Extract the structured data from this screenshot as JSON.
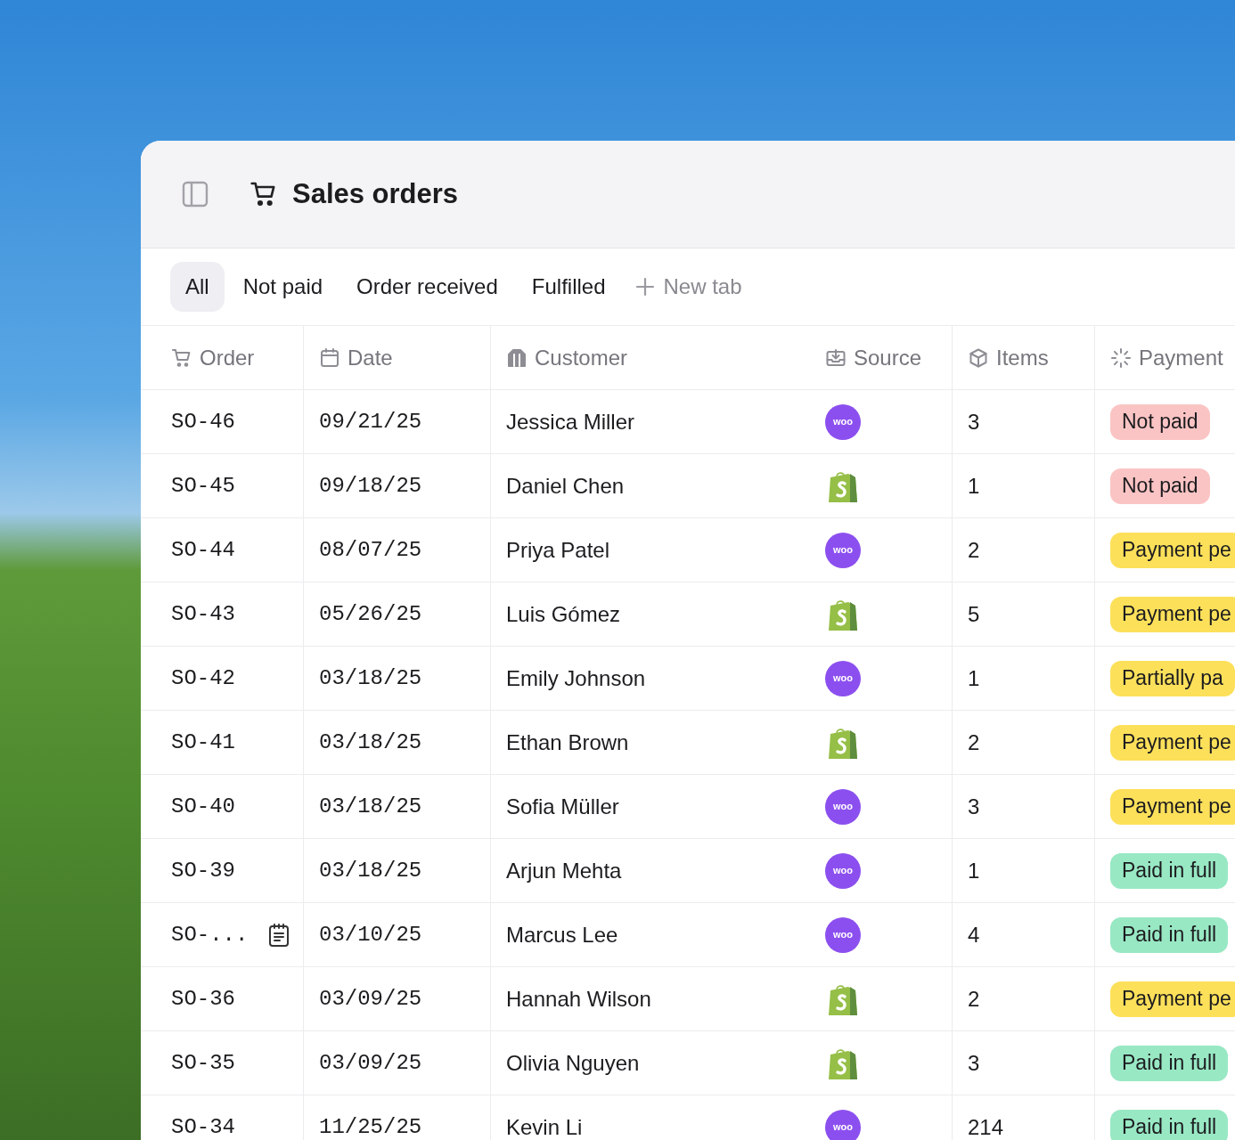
{
  "window": {
    "title": "Sales orders"
  },
  "tabs": [
    {
      "label": "All",
      "selected": true
    },
    {
      "label": "Not paid",
      "selected": false
    },
    {
      "label": "Order received",
      "selected": false
    },
    {
      "label": "Fulfilled",
      "selected": false
    }
  ],
  "new_tab": {
    "label": "New tab"
  },
  "table": {
    "columns": [
      {
        "kind": "cart",
        "label": "Order"
      },
      {
        "kind": "calendar",
        "label": "Date"
      },
      {
        "kind": "building",
        "label": "Customer"
      },
      {
        "kind": "inbox",
        "label": "Source"
      },
      {
        "kind": "cube",
        "label": "Items"
      },
      {
        "kind": "spinner",
        "label": "Payment"
      }
    ],
    "rows": [
      {
        "order": "SO-46",
        "note": false,
        "date": "09/21/25",
        "customer": "Jessica Miller",
        "source": {
          "kind": "circle",
          "text": "woo"
        },
        "items": "3",
        "payment": {
          "label": "Not paid",
          "color": "#fbc4c4"
        }
      },
      {
        "order": "SO-45",
        "note": false,
        "date": "09/18/25",
        "customer": "Daniel Chen",
        "source": {
          "kind": "bag"
        },
        "items": "1",
        "payment": {
          "label": "Not paid",
          "color": "#fbc4c4"
        }
      },
      {
        "order": "SO-44",
        "note": false,
        "date": "08/07/25",
        "customer": "Priya Patel",
        "source": {
          "kind": "circle",
          "text": "woo"
        },
        "items": "2",
        "payment": {
          "label": "Payment pe",
          "color": "#fde05a"
        }
      },
      {
        "order": "SO-43",
        "note": false,
        "date": "05/26/25",
        "customer": "Luis Gómez",
        "source": {
          "kind": "bag"
        },
        "items": "5",
        "payment": {
          "label": "Payment pe",
          "color": "#fde05a"
        }
      },
      {
        "order": "SO-42",
        "note": false,
        "date": "03/18/25",
        "customer": "Emily Johnson",
        "source": {
          "kind": "circle",
          "text": "woo"
        },
        "items": "1",
        "payment": {
          "label": "Partially pa",
          "color": "#fde05a"
        }
      },
      {
        "order": "SO-41",
        "note": false,
        "date": "03/18/25",
        "customer": "Ethan Brown",
        "source": {
          "kind": "bag"
        },
        "items": "2",
        "payment": {
          "label": "Payment pe",
          "color": "#fde05a"
        }
      },
      {
        "order": "SO-40",
        "note": false,
        "date": "03/18/25",
        "customer": "Sofia Müller",
        "source": {
          "kind": "circle",
          "text": "woo"
        },
        "items": "3",
        "payment": {
          "label": "Payment pe",
          "color": "#fde05a"
        }
      },
      {
        "order": "SO-39",
        "note": false,
        "date": "03/18/25",
        "customer": "Arjun Mehta",
        "source": {
          "kind": "circle",
          "text": "woo"
        },
        "items": "1",
        "payment": {
          "label": "Paid in full",
          "color": "#98e8c4"
        }
      },
      {
        "order": "SO-...",
        "note": true,
        "date": "03/10/25",
        "customer": "Marcus Lee",
        "source": {
          "kind": "circle",
          "text": "woo"
        },
        "items": "4",
        "payment": {
          "label": "Paid in full",
          "color": "#98e8c4"
        }
      },
      {
        "order": "SO-36",
        "note": false,
        "date": "03/09/25",
        "customer": "Hannah Wilson",
        "source": {
          "kind": "bag"
        },
        "items": "2",
        "payment": {
          "label": "Payment pe",
          "color": "#fde05a"
        }
      },
      {
        "order": "SO-35",
        "note": false,
        "date": "03/09/25",
        "customer": "Olivia Nguyen",
        "source": {
          "kind": "bag"
        },
        "items": "3",
        "payment": {
          "label": "Paid in full",
          "color": "#98e8c4"
        }
      },
      {
        "order": "SO-34",
        "note": false,
        "date": "11/25/25",
        "customer": "Kevin Li",
        "source": {
          "kind": "circle",
          "text": "woo"
        },
        "items": "214",
        "payment": {
          "label": "Paid in full",
          "color": "#98e8c4"
        }
      }
    ]
  }
}
